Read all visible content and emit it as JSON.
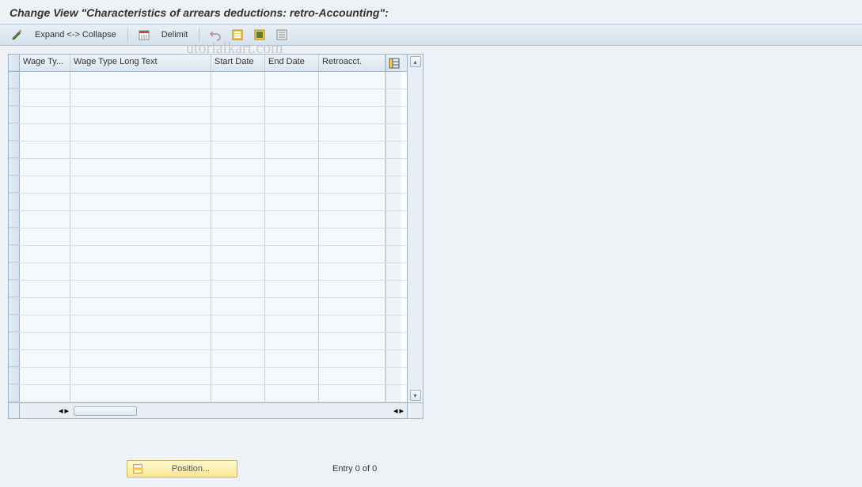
{
  "title": "Change View \"Characteristics of arrears deductions: retro-Accounting\":",
  "toolbar": {
    "expand_collapse": "Expand <-> Collapse",
    "delimit": "Delimit"
  },
  "table": {
    "columns": {
      "wage_type": "Wage Ty...",
      "wage_type_long": "Wage Type Long Text",
      "start_date": "Start Date",
      "end_date": "End Date",
      "retroacct": "Retroacct."
    },
    "row_count": 19
  },
  "footer": {
    "position_label": "Position...",
    "entry_text": "Entry 0 of 0"
  },
  "watermark": "utorialkart.com"
}
